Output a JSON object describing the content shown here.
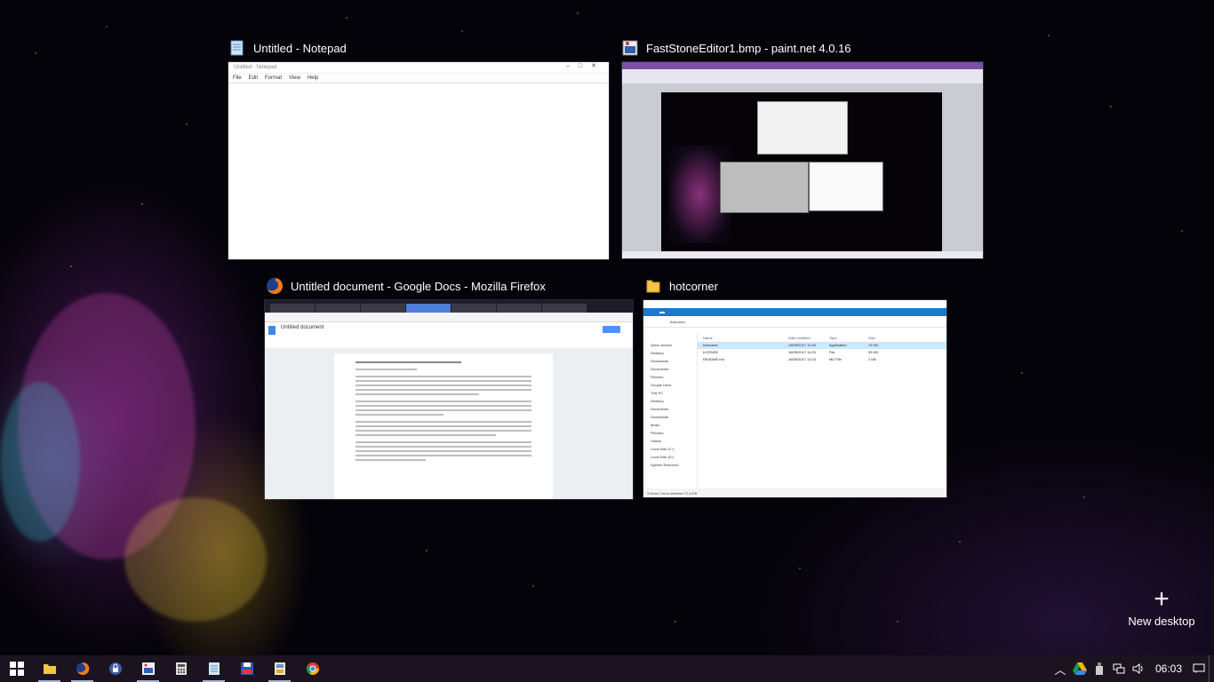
{
  "windows": {
    "notepad": {
      "title": "Untitled - Notepad",
      "inner_title": "Untitled - Notepad",
      "menu": [
        "File",
        "Edit",
        "Format",
        "View",
        "Help"
      ]
    },
    "paintnet": {
      "title": "FastStoneEditor1.bmp - paint.net 4.0.16"
    },
    "firefox": {
      "title": "Untitled document - Google Docs - Mozilla Firefox",
      "doc_name": "Untitled document"
    },
    "explorer": {
      "title": "hotcorner",
      "address": "hotcorner",
      "nav": [
        "Quick access",
        "Desktop",
        "Downloads",
        "Documents",
        "Pictures",
        "Google Drive",
        "This PC",
        "Desktop",
        "Documents",
        "Downloads",
        "Music",
        "Pictures",
        "Videos",
        "Local Disk (C:)",
        "Local Disk (D:)",
        "System Reserved"
      ],
      "columns": [
        "Name",
        "Date modified",
        "Type",
        "Size"
      ],
      "files": [
        {
          "name": "hotcorner",
          "date": "16/05/2017 11:06",
          "type": "Application",
          "size": "73 KB"
        },
        {
          "name": "LICENSE",
          "date": "16/05/2017 11:03",
          "type": "File",
          "size": "35 KB"
        },
        {
          "name": "README.md",
          "date": "16/05/2017 11:03",
          "type": "MD File",
          "size": "2 KB"
        }
      ],
      "status": "3 items    1 item selected  72,5 KB"
    }
  },
  "new_desktop": {
    "label": "New desktop"
  },
  "taskbar": {
    "apps": [
      "start",
      "file-explorer",
      "firefox",
      "keepass",
      "faststone-editor",
      "calculator",
      "notepad",
      "floppy-save",
      "paint-net",
      "chrome"
    ]
  },
  "tray": {
    "time": "06:03"
  }
}
